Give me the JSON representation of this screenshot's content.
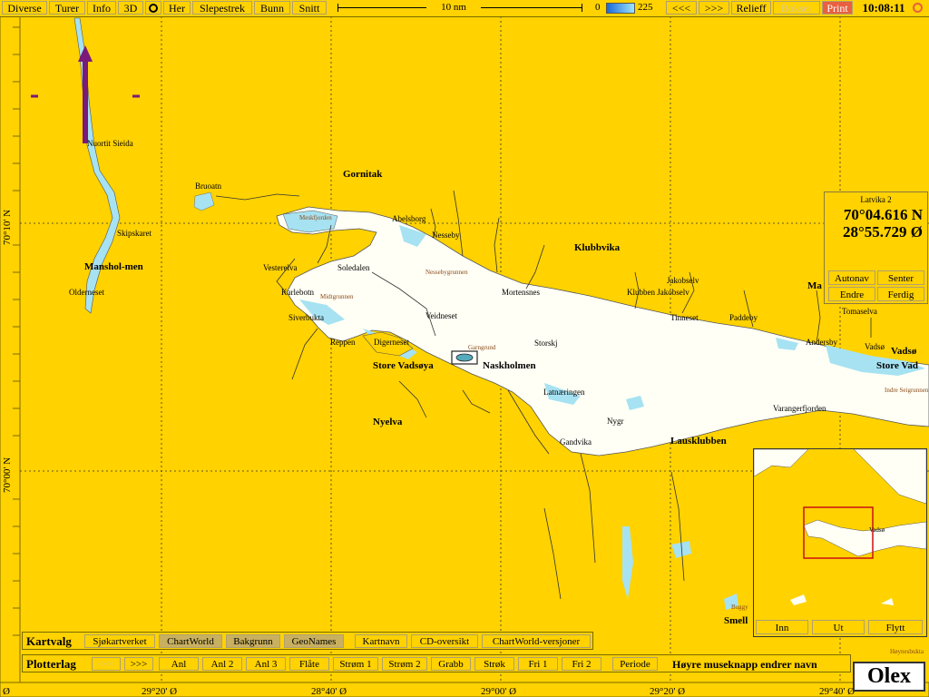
{
  "toolbar": {
    "buttons": [
      "Diverse",
      "Turer",
      "Info",
      "3D",
      "Her",
      "Slepestrek",
      "Bunn",
      "Snitt"
    ],
    "scale_label": "10 nm",
    "depth_min": "0",
    "depth_max": "225",
    "prev": "<<<",
    "next": ">>>",
    "relief": "Relieff",
    "boxes": "Bokser",
    "print": "Print",
    "time": "10:08:11"
  },
  "info_panel": {
    "title": "Latvika 2",
    "lat": "70°04.616 N",
    "lon": "28°55.729 Ø",
    "buttons": [
      "Autonav",
      "Senter",
      "Endre",
      "Ferdig"
    ]
  },
  "overview": {
    "label": "Vadsø",
    "buttons": [
      "Inn",
      "Ut",
      "Flytt"
    ]
  },
  "map_labels": {
    "gornitak": "Gornitak",
    "bruoatn": "Bruoatn",
    "nuortit": "Nuortit Sieida",
    "skipskaret": "Skipskaret",
    "manshol": "Manshol-men",
    "olderneset": "Olderneset",
    "abelsborg": "Abelsborg",
    "meskfjorden": "Meskfjorden",
    "nesseby": "Nesseby",
    "nessebygrunnen": "Nessebygrunnen",
    "vesterelva": "Vesterelva",
    "soledalen": "Soledalen",
    "karlebotn": "Karlebotn",
    "midtgrunnen": "Midtgrunnen",
    "siverbukta": "Siverbukta",
    "reppen": "Reppen",
    "digerneset": "Digerneset",
    "store_vadsoya": "Store Vadsøya",
    "naskholmen": "Naskholmen",
    "garngrund": "Garngrund",
    "veidneset": "Veidneset",
    "storskj": "Storskj",
    "latnaeringen": "Latnæringen",
    "nygr": "Nygr",
    "gandvika": "Gandvika",
    "lausklubben": "Lausklubben",
    "nyelva": "Nyelva",
    "mortensnes": "Mortensnes",
    "klubbvika": "Klubbvika",
    "klubben_jakobselv": "Klubben Jakobselv",
    "jakobselv": "Jakobselv",
    "tinneset": "Tinneset",
    "paddeby": "Paddeby",
    "andersby": "Andersby",
    "vadso": "Vadsø",
    "vadso2": "Vadsø",
    "store_vad": "Store Vad",
    "tomaselva": "Tomaselva",
    "indre_seig": "Indre Seigrunnen",
    "varangerfjorden": "Varangerfjorden",
    "ma": "Ma",
    "smell": "Smell",
    "buggy": "Buggy",
    "hoynesbukta": "Høynesbukta"
  },
  "lat_labels": [
    "70°10' N",
    "70°00' N"
  ],
  "lon_labels": [
    "Ø",
    "29°20' Ø",
    "28°40' Ø",
    "29°00' Ø",
    "29°20' Ø",
    "29°40' Ø"
  ],
  "kartvalg": {
    "title": "Kartvalg",
    "buttons": [
      "Sjøkartverket",
      "ChartWorld",
      "Bakgrunn",
      "GeoNames",
      "Kartnavn",
      "CD-oversikt",
      "ChartWorld-versjoner"
    ]
  },
  "plotterlag": {
    "title": "Plotterlag",
    "prev": "<<<",
    "next": ">>>",
    "buttons": [
      "Anl",
      "Anl 2",
      "Anl 3",
      "Flåte",
      "Strøm 1",
      "Strøm 2",
      "Grabb",
      "Strøk",
      "Fri 1",
      "Fri 2",
      "Periode"
    ],
    "hint": "Høyre museknapp endrer navn"
  },
  "brand": "Olex",
  "colors": {
    "land": "#ffd200",
    "water": "#fffff5",
    "shallow": "#a6e2f2",
    "track": "#7a1a7a",
    "marker": "#cc1111"
  }
}
